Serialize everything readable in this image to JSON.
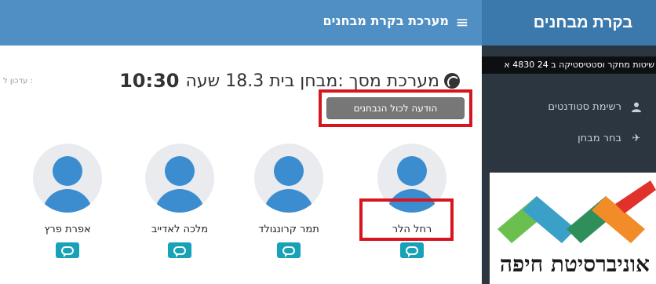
{
  "topbar": {
    "brand": "בקרת מבחנים",
    "menu_icon": "hamburger-icon",
    "subtitle": "מערכת בקרת מבחנים"
  },
  "sidebar": {
    "course": "שיטות מחקר וסטטיסטיקה ב 24 4830 א",
    "items": [
      {
        "label": "רשימת סטודנטים",
        "icon": "user-icon"
      },
      {
        "label": "בחר מבחן",
        "icon": "plane-icon"
      }
    ],
    "logo_text": "אוניברסיטת חיפה",
    "logo_colors": [
      "#e0322b",
      "#f28c28",
      "#2f8f5b",
      "#3aa0c8",
      "#6bbf4e"
    ]
  },
  "main": {
    "updated": "עדכון ל :",
    "headline_prefix": "מערכת מסך :מבחן בית 18.3 שעה",
    "headline_time": "10:30",
    "notify_button": "הודעה לכול הנבחנים"
  },
  "students": [
    {
      "name": "רחל הלר"
    },
    {
      "name": "תמר קרונגולד"
    },
    {
      "name": "מלכה לאדייב"
    },
    {
      "name": "אפרת פרץ"
    }
  ],
  "colors": {
    "topbar": "#4f8fc3",
    "brand_bg": "#3b79ad",
    "sidebar": "#2b3640",
    "avatar": "#3c8dd0",
    "chat_button": "#17a2b8",
    "highlight": "#d7151f"
  }
}
